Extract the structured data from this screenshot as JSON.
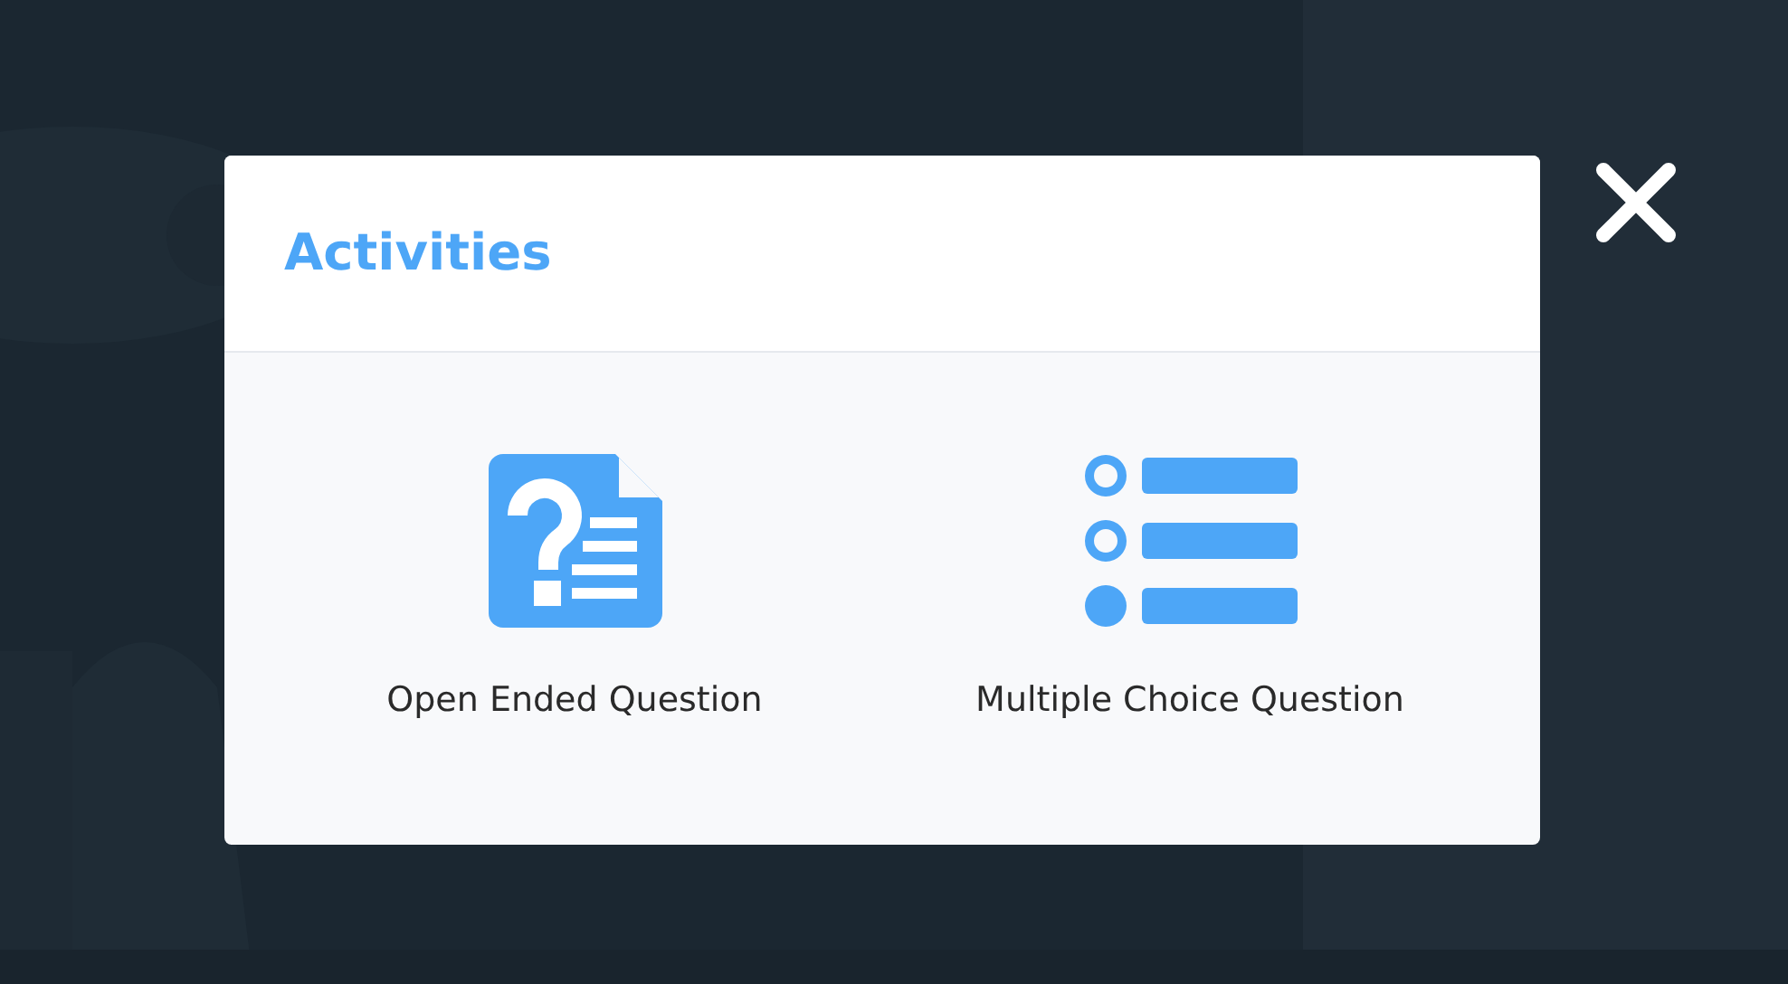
{
  "dialog": {
    "title": "Activities",
    "items": [
      {
        "kind": "open-ended",
        "label": "Open Ended Question"
      },
      {
        "kind": "multiple-choice",
        "label": "Multiple Choice Question"
      }
    ]
  }
}
